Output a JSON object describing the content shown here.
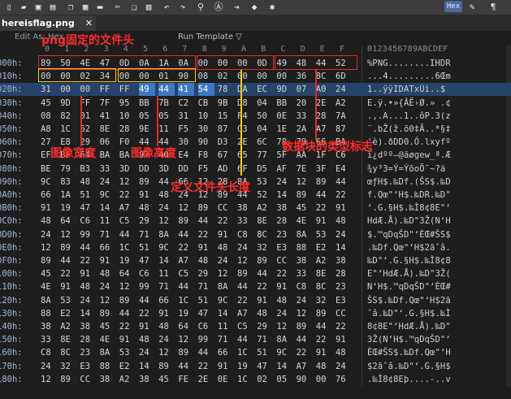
{
  "toolbar": {
    "hex_label": "Hex",
    "icons": [
      "new-file-icon",
      "open-folder-icon",
      "save-icon",
      "save-all-icon",
      "copy-icon",
      "paste-icon",
      "folder-icon",
      "cut-icon",
      "copy2-icon",
      "paste2-icon",
      "undo-icon",
      "redo-icon",
      "find-icon",
      "replace-icon",
      "goto-icon",
      "bookmark-icon",
      "settings-icon",
      "hex-icon",
      "edit-icon",
      "paragraph-icon"
    ]
  },
  "tab": {
    "label": "hereisflag.png",
    "close": "✕"
  },
  "header": {
    "edit_as": "Edit As: Hex",
    "run_template": "Run Template ▽",
    "columns": [
      "0",
      "1",
      "2",
      "3",
      "4",
      "5",
      "6",
      "7",
      "8",
      "9",
      "A",
      "B",
      "C",
      "D",
      "E",
      "F"
    ],
    "ascii_header": "0123456789ABCDEF"
  },
  "rows": [
    {
      "addr": "000h:",
      "bytes": [
        "89",
        "50",
        "4E",
        "47",
        "0D",
        "0A",
        "1A",
        "0A",
        "00",
        "00",
        "00",
        "0D",
        "49",
        "48",
        "44",
        "52"
      ],
      "ascii": "%PNG........IHDR"
    },
    {
      "addr": "010h:",
      "bytes": [
        "00",
        "00",
        "02",
        "34",
        "00",
        "00",
        "01",
        "90",
        "08",
        "02",
        "00",
        "00",
        "00",
        "36",
        "8C",
        "6D"
      ],
      "ascii": "...4.........6Œm"
    },
    {
      "addr": "020h:",
      "bytes": [
        "31",
        "00",
        "00",
        "FF",
        "FF",
        "49",
        "44",
        "41",
        "54",
        "78",
        "DA",
        "EC",
        "9D",
        "07",
        "A0",
        "24"
      ],
      "ascii": "1..ÿÿIDATxÚì..$"
    },
    {
      "addr": "030h:",
      "bytes": [
        "45",
        "9D",
        "FF",
        "7F",
        "95",
        "BB",
        "7B",
        "C2",
        "CB",
        "9B",
        "D8",
        "04",
        "BB",
        "20",
        "2E",
        "A2"
      ],
      "ascii": "E.ÿ.•»{ÂË›Ø.» .¢"
    },
    {
      "addr": "040h:",
      "bytes": [
        "08",
        "82",
        "01",
        "41",
        "10",
        "05",
        "05",
        "31",
        "10",
        "15",
        "F4",
        "50",
        "0E",
        "33",
        "28",
        "7A"
      ],
      "ascii": ".‚.A...1..ôP.3(z"
    },
    {
      "addr": "050h:",
      "bytes": [
        "A8",
        "1C",
        "62",
        "8E",
        "28",
        "9E",
        "11",
        "F5",
        "30",
        "87",
        "C3",
        "04",
        "1E",
        "2A",
        "A7",
        "87"
      ],
      "ascii": "¨.bŽ(ž.õ0‡Ã..*§‡"
    },
    {
      "addr": "060h:",
      "bytes": [
        "27",
        "E8",
        "29",
        "06",
        "F0",
        "44",
        "44",
        "30",
        "90",
        "D3",
        "2E",
        "6C",
        "78",
        "79",
        "66",
        "BA"
      ],
      "ascii": "'è).ðDD0.Ó.lxyfº"
    },
    {
      "addr": "070h:",
      "bytes": [
        "EF",
        "BF",
        "64",
        "BA",
        "BA",
        "97",
        "40",
        "E4",
        "F8",
        "67",
        "65",
        "77",
        "5F",
        "AA",
        "1F",
        "C6"
      ],
      "ascii": "ï¿dºº—@äøgew_ª.Æ"
    },
    {
      "addr": "080h:",
      "bytes": [
        "BE",
        "79",
        "B3",
        "33",
        "3D",
        "DD",
        "3D",
        "DD",
        "F5",
        "AD",
        "6F",
        "D5",
        "AF",
        "7E",
        "3F",
        "E4"
      ],
      "ascii": "¾y³3=Ý=Ýõ­oÕ¯~?ä"
    },
    {
      "addr": "090h:",
      "bytes": [
        "9C",
        "83",
        "48",
        "24",
        "12",
        "89",
        "44",
        "66",
        "12",
        "28",
        "8A",
        "53",
        "24",
        "12",
        "89",
        "44"
      ],
      "ascii": "œƒH$.‰Df.(ŠS$.‰D"
    },
    {
      "addr": "0A0h:",
      "bytes": [
        "66",
        "1A",
        "51",
        "9C",
        "22",
        "91",
        "48",
        "24",
        "12",
        "89",
        "44",
        "52",
        "14",
        "89",
        "44",
        "22"
      ],
      "ascii": "f.Qœ\"‘H$.‰DR.‰D\""
    },
    {
      "addr": "0B0h:",
      "bytes": [
        "91",
        "19",
        "47",
        "14",
        "A7",
        "48",
        "24",
        "12",
        "89",
        "CC",
        "38",
        "A2",
        "38",
        "45",
        "22",
        "91"
      ],
      "ascii": "‘.G.§H$.‰Ì8¢8E\"‘"
    },
    {
      "addr": "0C0h:",
      "bytes": [
        "48",
        "64",
        "C6",
        "11",
        "C5",
        "29",
        "12",
        "89",
        "44",
        "22",
        "33",
        "8E",
        "28",
        "4E",
        "91",
        "48"
      ],
      "ascii": "HdÆ.Å).‰D\"3Ž(N‘H"
    },
    {
      "addr": "0D0h:",
      "bytes": [
        "24",
        "12",
        "99",
        "71",
        "44",
        "71",
        "8A",
        "44",
        "22",
        "91",
        "C8",
        "8C",
        "23",
        "8A",
        "53",
        "24"
      ],
      "ascii": "$.™qDqŠD\"‘ÈŒ#ŠS$"
    },
    {
      "addr": "0E0h:",
      "bytes": [
        "12",
        "89",
        "44",
        "66",
        "1C",
        "51",
        "9C",
        "22",
        "91",
        "48",
        "24",
        "32",
        "E3",
        "88",
        "E2",
        "14"
      ],
      "ascii": ".‰Df.Qœ\"‘H$2ãˆâ."
    },
    {
      "addr": "0F0h:",
      "bytes": [
        "89",
        "44",
        "22",
        "91",
        "19",
        "47",
        "14",
        "A7",
        "48",
        "24",
        "12",
        "89",
        "CC",
        "38",
        "A2",
        "38"
      ],
      "ascii": "‰D\"‘.G.§H$.‰Ì8¢8"
    },
    {
      "addr": "100h:",
      "bytes": [
        "45",
        "22",
        "91",
        "48",
        "64",
        "C6",
        "11",
        "C5",
        "29",
        "12",
        "89",
        "44",
        "22",
        "33",
        "8E",
        "28"
      ],
      "ascii": "E\"‘HdÆ.Å).‰D\"3Ž("
    },
    {
      "addr": "110h:",
      "bytes": [
        "4E",
        "91",
        "48",
        "24",
        "12",
        "99",
        "71",
        "44",
        "71",
        "8A",
        "44",
        "22",
        "91",
        "C8",
        "8C",
        "23"
      ],
      "ascii": "N‘H$.™qDqŠD\"‘ÈŒ#"
    },
    {
      "addr": "120h:",
      "bytes": [
        "8A",
        "53",
        "24",
        "12",
        "89",
        "44",
        "66",
        "1C",
        "51",
        "9C",
        "22",
        "91",
        "48",
        "24",
        "32",
        "E3"
      ],
      "ascii": "ŠS$.‰Df.Qœ\"‘H$2ã"
    },
    {
      "addr": "130h:",
      "bytes": [
        "88",
        "E2",
        "14",
        "89",
        "44",
        "22",
        "91",
        "19",
        "47",
        "14",
        "A7",
        "48",
        "24",
        "12",
        "89",
        "CC"
      ],
      "ascii": "ˆâ.‰D\"‘.G.§H$.‰Ì"
    },
    {
      "addr": "140h:",
      "bytes": [
        "38",
        "A2",
        "38",
        "45",
        "22",
        "91",
        "48",
        "64",
        "C6",
        "11",
        "C5",
        "29",
        "12",
        "89",
        "44",
        "22"
      ],
      "ascii": "8¢8E\"‘HdÆ.Å).‰D\""
    },
    {
      "addr": "150h:",
      "bytes": [
        "33",
        "8E",
        "28",
        "4E",
        "91",
        "48",
        "24",
        "12",
        "99",
        "71",
        "44",
        "71",
        "8A",
        "44",
        "22",
        "91"
      ],
      "ascii": "3Ž(N‘H$.™qDqŠD\"‘"
    },
    {
      "addr": "160h:",
      "bytes": [
        "C8",
        "8C",
        "23",
        "8A",
        "53",
        "24",
        "12",
        "89",
        "44",
        "66",
        "1C",
        "51",
        "9C",
        "22",
        "91",
        "48"
      ],
      "ascii": "ÈŒ#ŠS$.‰Df.Qœ\"‘H"
    },
    {
      "addr": "170h:",
      "bytes": [
        "24",
        "32",
        "E3",
        "88",
        "E2",
        "14",
        "89",
        "44",
        "22",
        "91",
        "19",
        "47",
        "14",
        "A7",
        "48",
        "24"
      ],
      "ascii": "$2ãˆâ.‰D\"‘.G.§H$"
    },
    {
      "addr": "180h:",
      "bytes": [
        "12",
        "89",
        "CC",
        "38",
        "A2",
        "38",
        "45",
        "FE",
        "2E",
        "0E",
        "1C",
        "02",
        "05",
        "90",
        "00",
        "76"
      ],
      "ascii": ".‰Ì8¢8Eþ....‐..v"
    }
  ],
  "annotations": {
    "png_header": "png固定的文件头",
    "width": "图像宽度",
    "height": "图像高度",
    "chunk_type": "数据块的类型标志",
    "header_length": "定义文件头长度"
  }
}
